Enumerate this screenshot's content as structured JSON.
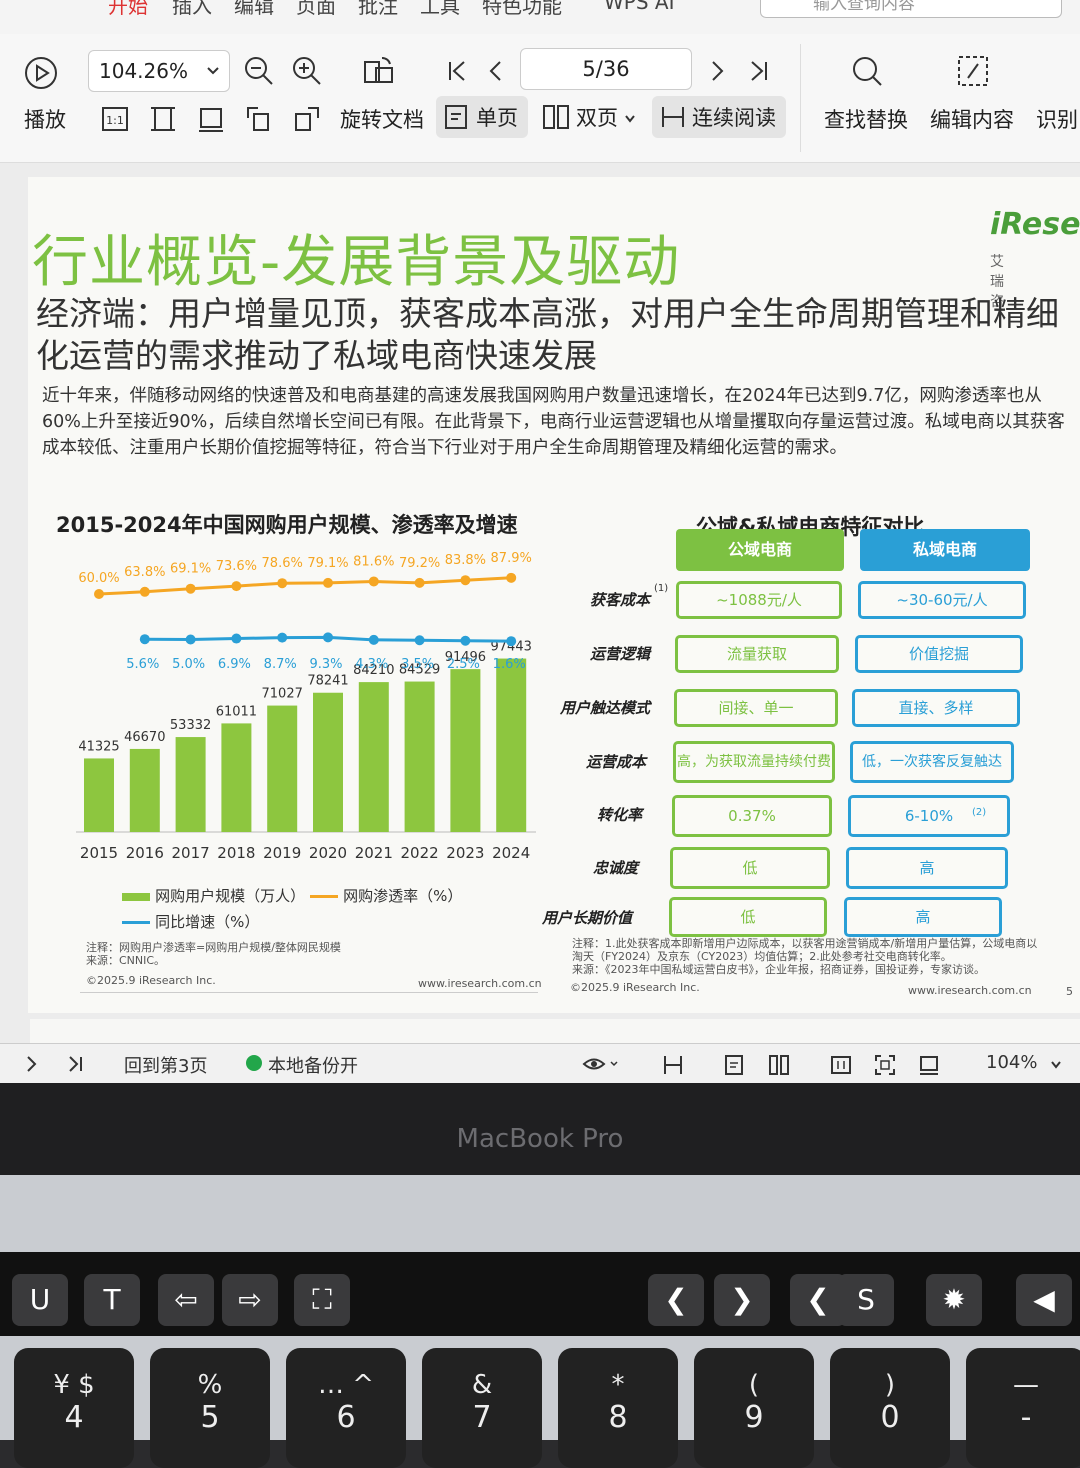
{
  "menu": [
    "开始",
    "插入",
    "编辑",
    "页面",
    "批注",
    "工具",
    "特色功能",
    "WPS AI"
  ],
  "search_placeholder": "输入查询内容",
  "toolbar": {
    "play": "播放",
    "zoom": "104.26%",
    "rotate": "旋转文档",
    "single": "单页",
    "double": "双页",
    "continuous": "连续阅读",
    "page": "5/36",
    "find": "查找替换",
    "edit": "编辑内容",
    "recognize": "识别"
  },
  "doc": {
    "title": "行业概览-发展背景及驱动",
    "logo": "iResea",
    "logo_sub": "艾 瑞 咨",
    "subtitle": "经济端：用户增量见顶，获客成本高涨，对用户全生命周期管理和精细化运营的需求推动了私域电商快速发展",
    "intro": "近十年来，伴随移动网络的快速普及和电商基建的高速发展我国网购用户数量迅速增长，在2024年已达到9.7亿，网购渗透率也从60%上升至接近90%，后续自然增长空间已有限。在此背景下，电商行业运营逻辑也从增量攫取向存量运营过渡。私域电商以其获客成本较低、注重用户长期价值挖掘等特征，符合当下行业对于用户全生命周期管理及精细化运营的需求。",
    "chart_title": "2015-2024年中国网购用户规模、渗透率及增速",
    "legend": [
      "网购用户规模（万人）",
      "网购渗透率（%）",
      "同比增速（%）"
    ],
    "chart_note": "注释：网购用户渗透率=网购用户规模/整体网民规模",
    "chart_source": "来源：CNNIC。",
    "copyright": "©2025.9 iResearch Inc.",
    "site": "www.iresearch.com.cn",
    "compare_title": "公域&私域电商特征对比",
    "col_public": "公域电商",
    "col_private": "私域电商",
    "rows": [
      {
        "label": "获客成本",
        "public": "~1088元/人",
        "private": "~30-60元/人"
      },
      {
        "label": "运营逻辑",
        "public": "流量获取",
        "private": "价值挖掘"
      },
      {
        "label": "用户触达模式",
        "public": "间接、单一",
        "private": "直接、多样"
      },
      {
        "label": "运营成本",
        "public": "高，为获取流量持续付费",
        "private": "低，一次获客反复触达"
      },
      {
        "label": "转化率",
        "public": "0.37%",
        "private": "6-10%"
      },
      {
        "label": "忠诚度",
        "public": "低",
        "private": "高"
      },
      {
        "label": "用户长期价值",
        "public": "低",
        "private": "高"
      }
    ],
    "compare_note": "注释：1.此处获客成本即新增用户边际成本，以获客用途营销成本/新增用户量估算，公域电商以淘天（FY2024）及京东（CY2023）均值估算；2.此处参考社交电商转化率。",
    "compare_source": "来源：《2023年中国私域运营白皮书》，企业年报，招商证券，国投证券，专家访谈。",
    "page_no": "5"
  },
  "chart_data": {
    "type": "bar",
    "title": "2015-2024年中国网购用户规模、渗透率及增速",
    "categories": [
      "2015",
      "2016",
      "2017",
      "2018",
      "2019",
      "2020",
      "2021",
      "2022",
      "2023",
      "2024"
    ],
    "series": [
      {
        "name": "网购用户规模（万人）",
        "kind": "bar",
        "color": "#8dc63f",
        "values": [
          41325,
          46670,
          53332,
          61011,
          71027,
          78241,
          84210,
          84529,
          91496,
          97443
        ]
      },
      {
        "name": "网购渗透率（%）",
        "kind": "line",
        "color": "#f5a623",
        "values": [
          60.0,
          63.8,
          69.1,
          73.6,
          78.6,
          79.1,
          81.6,
          79.2,
          83.8,
          87.9
        ]
      },
      {
        "name": "同比增速（%）",
        "kind": "line",
        "color": "#2a9fd6",
        "values": [
          null,
          5.6,
          5.0,
          6.9,
          8.7,
          9.3,
          4.3,
          3.5,
          2.5,
          1.6
        ]
      }
    ],
    "ylim": [
      0,
      100000
    ],
    "legend_position": "bottom"
  },
  "statusbar": {
    "back": "回到第3页",
    "backup": "本地备份开",
    "zoom": "104%"
  },
  "device_label": "MacBook Pro",
  "keys": {
    "touchbar": [
      "U",
      "T",
      "⇦",
      "⇨",
      "⛶",
      "❮",
      "❯",
      "❮",
      "S",
      "✹",
      "◀"
    ],
    "row": [
      [
        "¥ $",
        "4"
      ],
      [
        "%",
        "5"
      ],
      [
        "… ^",
        "6"
      ],
      [
        "&",
        "7"
      ],
      [
        "*",
        "8"
      ],
      [
        "(",
        "9"
      ],
      [
        ")",
        "0"
      ],
      [
        "—",
        "-"
      ]
    ]
  }
}
